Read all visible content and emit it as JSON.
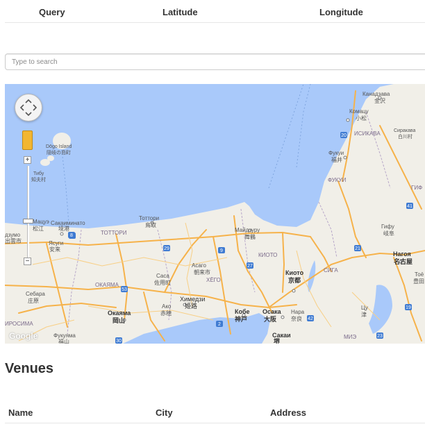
{
  "queries_table": {
    "columns": [
      "Query",
      "Latitude",
      "Longitude"
    ]
  },
  "search": {
    "placeholder": "Type to search"
  },
  "map": {
    "attribution": "Google",
    "zoom_in": "+",
    "zoom_out": "−",
    "labels": {
      "kanazawa": "Канадзава",
      "kanazawa_jp": "金沢",
      "komatsu": "Комацу",
      "komatsu_jp": "小松",
      "ishikawa": "ИСИКАВА",
      "shirakawa": "Сиракава",
      "shirakawa_jp": "白川村",
      "fukui": "Фукуи",
      "fukui_jp": "福井",
      "fukui_pref": "ФУКУИ",
      "gifu_pref": "ГИФ",
      "dogo": "Dōgo Island",
      "dogo_jp": "隠岐の島町",
      "chibu": "Тибу",
      "chibu_jp": "知夫村",
      "tottori": "Тоттори",
      "tottori_jp": "鳥取",
      "tottori_pref": "ТОТТОРИ",
      "maizuru": "Майдзуру",
      "maizuru_jp": "舞鶴",
      "kyoto_pref": "КИОТО",
      "matsue": "Мацуэ",
      "matsue_jp": "松江",
      "sakaiminato": "Сакаиминато",
      "sakaiminato_jp": "境港",
      "izumo": "дзумо",
      "izumo_jp": "出雲市",
      "yasugi": "Ясуги",
      "yasugi_jp": "安来",
      "asago": "Асаго",
      "asago_jp": "朝来市",
      "gifu": "Гифу",
      "gifu_jp": "岐阜",
      "nagoya": "Нагоя",
      "nagoya_jp": "名古屋",
      "toyo": "Тоё",
      "toyo_jp": "豊田",
      "kyoto": "Киото",
      "kyoto_jp": "京都",
      "shiga": "СИГА",
      "hyogo": "ХЁГО",
      "okayama_pref": "ОКАЯМА",
      "sasa": "Саса",
      "sasa_jp": "佐用町",
      "sebara": "Себара",
      "sebara_jp": "庄原",
      "himeji": "Химедзи",
      "himeji_jp": "姫路",
      "ako": "Ако",
      "ako_jp": "赤穂",
      "kobe": "Кобе",
      "kobe_jp": "神戸",
      "osaka": "Осака",
      "osaka_jp": "大阪",
      "nara": "Нара",
      "nara_jp": "奈良",
      "sakai": "Сакаи",
      "sakai_jp": "堺",
      "tsu": "Цу",
      "tsu_jp": "津",
      "okayama": "Окаяма",
      "okayama_jp": "岡山",
      "hiroshima": "ИРОСИМА",
      "fukuyama": "Фукуяма",
      "fukuyama_jp": "福山",
      "mie": "МИЭ"
    },
    "shields": [
      "8",
      "9",
      "29",
      "9",
      "27",
      "1",
      "21",
      "53",
      "42",
      "2",
      "30",
      "23",
      "2",
      "1",
      "20",
      "41",
      "19"
    ]
  },
  "venues": {
    "heading": "Venues",
    "columns": [
      "Name",
      "City",
      "Address"
    ]
  },
  "colors": {
    "water": "#a9c9fa",
    "land": "#f1efe8",
    "road": "#f6b24a",
    "text": "#333333"
  }
}
